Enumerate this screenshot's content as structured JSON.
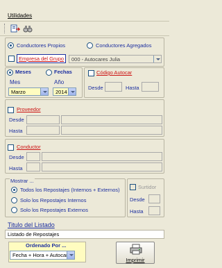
{
  "menu": {
    "utilidades": "Utilidades"
  },
  "toolbar": {
    "icon1": "export-icon",
    "icon2": "binoculars-icon"
  },
  "conductores": {
    "propios": "Conductores Propios",
    "agregados": "Conductores Agregados"
  },
  "empresa": {
    "label": "Empresa del Grupo",
    "value": "000 - Autocares Julia"
  },
  "periodo": {
    "meses": "Meses",
    "fechas": "Fechas",
    "mes_label": "Mes",
    "ano_label": "Año",
    "mes_value": "Marzo",
    "ano_value": "2014"
  },
  "codigo": {
    "label": "Código Autocar",
    "desde": "Desde",
    "hasta": "Hasta"
  },
  "proveedor": {
    "label": "Proveedor",
    "desde": "Desde",
    "hasta": "Hasta"
  },
  "conductor": {
    "label": "Conductor",
    "desde": "Desde",
    "hasta": "Hasta"
  },
  "mostrar": {
    "title": "Mostrar ...",
    "opt1": "Todos los Repostajes (Internos + Externos)",
    "opt2": "Solo los Repostajes Internos",
    "opt3": "Solo los Repostajes Externos"
  },
  "surtidor": {
    "label": "Surtidor",
    "desde": "Desde",
    "hasta": "Hasta"
  },
  "titulo": {
    "label": "Titulo del Listado",
    "value": "Listado de Repostajes"
  },
  "ordenado": {
    "label": "Ordenado Por ...",
    "value": "Fecha + Hora + Autocar"
  },
  "imprimir": {
    "label": "Imprimir"
  }
}
